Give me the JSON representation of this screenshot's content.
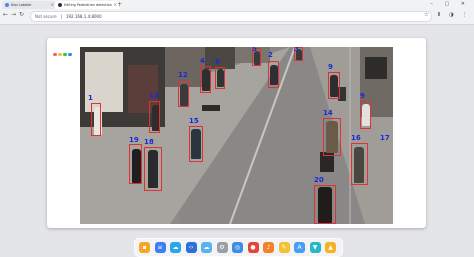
{
  "browser": {
    "tabs": [
      {
        "label": "Kiwi Labeler"
      },
      {
        "label": "Editing Pedestrian detection"
      }
    ],
    "new_tab_label": "+",
    "window_controls": "– ▢ ✕",
    "security_label": "Not secure",
    "url": "192.168.1.4:8000",
    "toolbar_icons": "☆ ⬇ ◑ ⋮"
  },
  "window": {
    "dot_colors": [
      "#ff5f57",
      "#febc2e",
      "#28c840",
      "#3b82f6"
    ]
  },
  "detections": [
    {
      "label": "1"
    },
    {
      "label": "2"
    },
    {
      "label": "3"
    },
    {
      "label": "4"
    },
    {
      "label": "5"
    },
    {
      "label": "6"
    },
    {
      "label": "9"
    },
    {
      "label": "9"
    },
    {
      "label": "12"
    },
    {
      "label": "13"
    },
    {
      "label": "14"
    },
    {
      "label": "15"
    },
    {
      "label": "16"
    },
    {
      "label": "17"
    },
    {
      "label": "18"
    },
    {
      "label": "19"
    },
    {
      "label": "20"
    }
  ],
  "dock": {
    "apps": [
      {
        "name": "files",
        "color": "#f5a623"
      },
      {
        "name": "docs",
        "color": "#3d7ef0"
      },
      {
        "name": "cloud",
        "color": "#2aa7e8"
      },
      {
        "name": "code",
        "color": "#2f6fd6"
      },
      {
        "name": "weather",
        "color": "#5ab2ef"
      },
      {
        "name": "settings",
        "color": "#9aa0a8"
      },
      {
        "name": "browser",
        "color": "#3a8fe5"
      },
      {
        "name": "recorder",
        "color": "#e0463c"
      },
      {
        "name": "music",
        "color": "#f0822a"
      },
      {
        "name": "notes",
        "color": "#f2c230"
      },
      {
        "name": "store",
        "color": "#4a9df0"
      },
      {
        "name": "vpn",
        "color": "#27b8c8"
      },
      {
        "name": "navigation",
        "color": "#f5b320"
      }
    ]
  }
}
